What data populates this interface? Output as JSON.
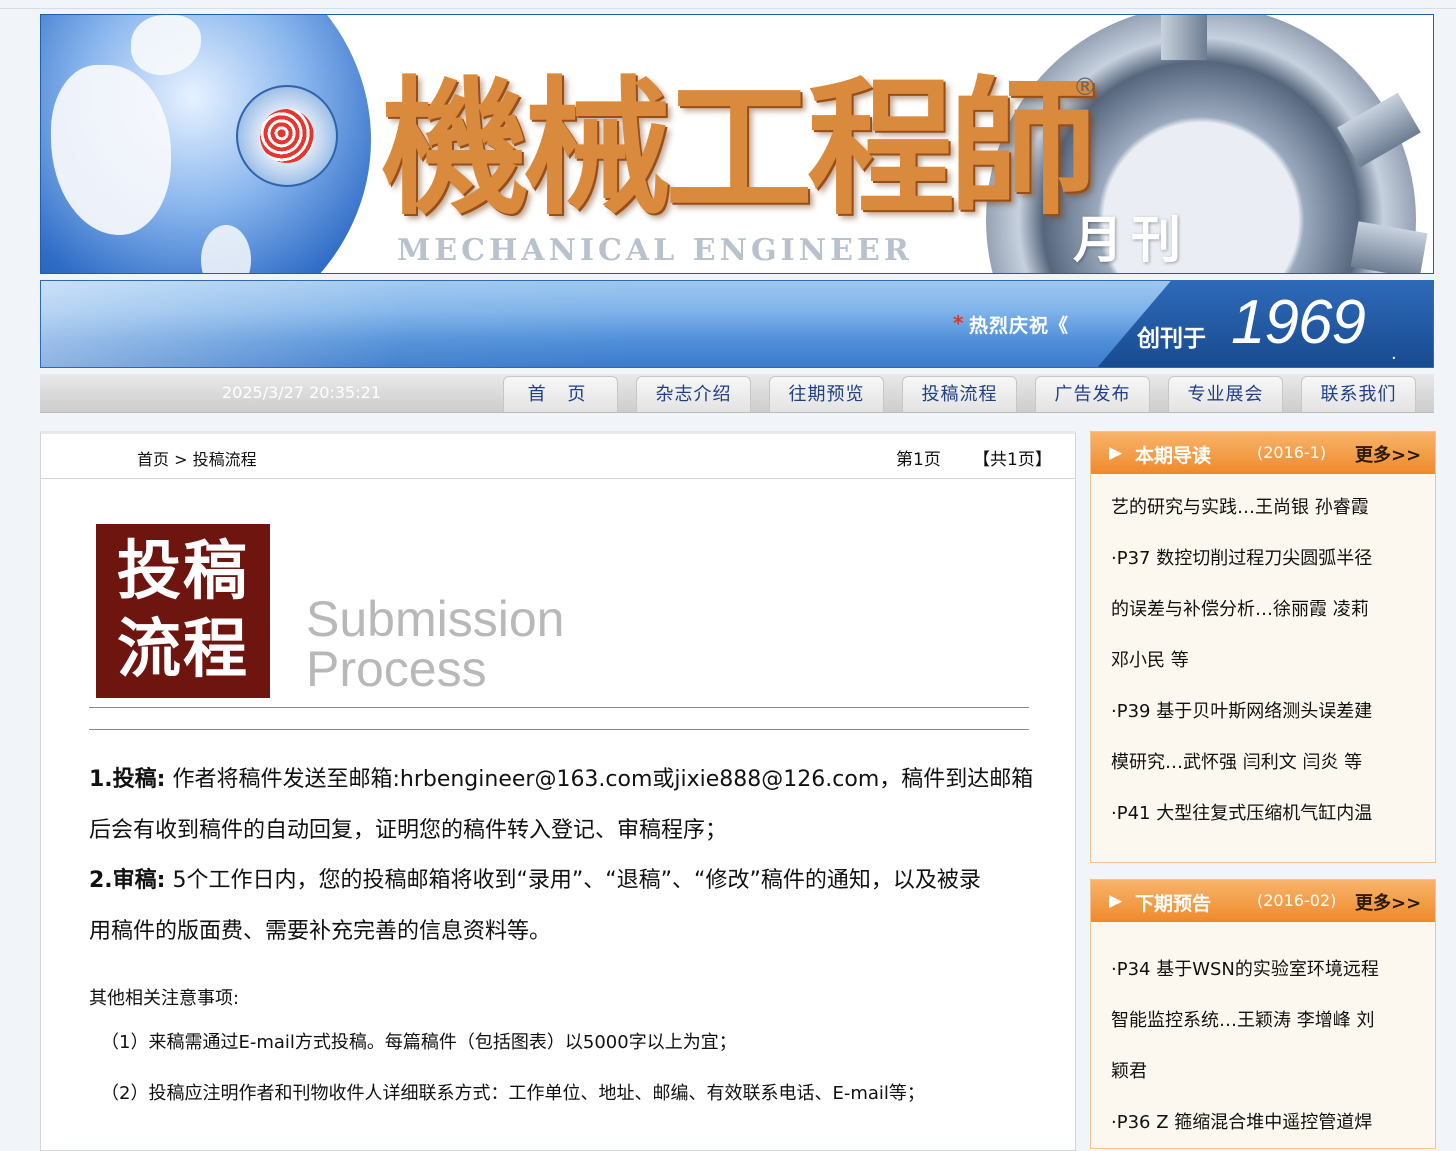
{
  "header": {
    "masthead": "機械工程師",
    "registered": "®",
    "english": "MECHANICAL ENGINEER",
    "monthly": "月刊"
  },
  "strip": {
    "star": "*",
    "celebrate": "热烈庆祝《",
    "founded_label": "创刊于",
    "founded_year": "1969",
    "founded_dot": "."
  },
  "nav": {
    "datetime": "2025/3/27 20:35:21",
    "tabs": [
      "首 页",
      "杂志介绍",
      "往期预览",
      "投稿流程",
      "广告发布",
      "专业展会",
      "联系我们"
    ]
  },
  "main": {
    "breadcrumb": "首页 > 投稿流程",
    "page_no": "第1页",
    "page_total": "【共1页】",
    "title_cn_line1": "投稿",
    "title_cn_line2": "流程",
    "title_en_line1": "Submission",
    "title_en_line2": "Process",
    "step1_label": "1.投稿:",
    "step1_text_a": " 作者将稿件发送至邮箱:hrbengineer@163.com或jixie888@126.com，稿件到达邮箱",
    "step1_text_b": "后会有收到稿件的自动回复，证明您的稿件转入登记、审稿程序；",
    "step2_label": "2.审稿:",
    "step2_text_a": " 5个工作日内，您的投稿邮箱将收到“录用”、“退稿”、“修改”稿件的通知，以及被录",
    "step2_text_b": "用稿件的版面费、需要补充完善的信息资料等。",
    "notes_title": "其他相关注意事项:",
    "notes": [
      "（1）来稿需通过E-mail方式投稿。每篇稿件（包括图表）以5000字以上为宜；",
      "（2）投稿应注明作者和刊物收件人详细联系方式：工作单位、地址、邮编、有效联系电话、E-mail等；"
    ]
  },
  "sidebar": {
    "current": {
      "title": "本期导读",
      "issue": "(2016-1)",
      "more": "更多>>",
      "lines": [
        "艺的研究与实践…王尚银 孙睿霞",
        "·P37 数控切削过程刀尖圆弧半径",
        "的误差与补偿分析…徐丽霞 凌莉",
        "邓小民 等",
        "·P39 基于贝叶斯网络测头误差建",
        "模研究…武怀强 闫利文 闫炎 等",
        "·P41 大型往复式压缩机气缸内温"
      ]
    },
    "next": {
      "title": "下期预告",
      "issue": "(2016-02)",
      "more": "更多>>",
      "lines": [
        "·P34 基于WSN的实验室环境远程",
        "智能监控系统…王颖涛 李增峰 刘",
        "颖君",
        "·P36 Z 箍缩混合堆中遥控管道焊"
      ]
    }
  }
}
